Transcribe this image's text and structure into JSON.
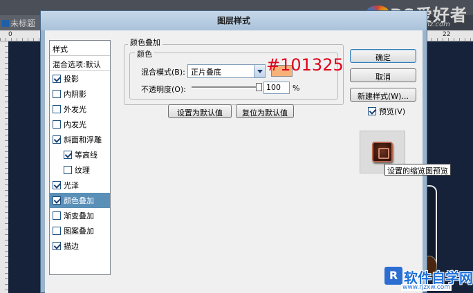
{
  "workspace": {
    "tab_title": "未标题",
    "ruler_left": "0",
    "ruler_right": "22"
  },
  "watermarks": {
    "top_brand": "PS爱好者",
    "top_url": "www.psahz.com",
    "bottom_icon": "R",
    "bottom_brand": "软件自学网",
    "bottom_url": "www.rjzxw.com"
  },
  "dialog": {
    "title": "图层样式"
  },
  "style_list": {
    "header": "样式",
    "blend_options": "混合选项:默认",
    "items": [
      {
        "label": "投影",
        "checked": true,
        "indent": false,
        "selected": false
      },
      {
        "label": "内阴影",
        "checked": false,
        "indent": false,
        "selected": false
      },
      {
        "label": "外发光",
        "checked": false,
        "indent": false,
        "selected": false
      },
      {
        "label": "内发光",
        "checked": false,
        "indent": false,
        "selected": false
      },
      {
        "label": "斜面和浮雕",
        "checked": true,
        "indent": false,
        "selected": false
      },
      {
        "label": "等高线",
        "checked": true,
        "indent": true,
        "selected": false
      },
      {
        "label": "纹理",
        "checked": false,
        "indent": true,
        "selected": false
      },
      {
        "label": "光泽",
        "checked": true,
        "indent": false,
        "selected": false
      },
      {
        "label": "颜色叠加",
        "checked": true,
        "indent": false,
        "selected": true
      },
      {
        "label": "渐变叠加",
        "checked": false,
        "indent": false,
        "selected": false
      },
      {
        "label": "图案叠加",
        "checked": false,
        "indent": false,
        "selected": false
      },
      {
        "label": "描边",
        "checked": true,
        "indent": false,
        "selected": false
      }
    ]
  },
  "color_overlay": {
    "group_title": "颜色叠加",
    "subgroup_title": "颜色",
    "blend_mode_label": "混合模式(B):",
    "blend_mode_value": "正片叠底",
    "swatch_color": "#f7b27a",
    "opacity_label": "不透明度(O):",
    "opacity_value": "100",
    "opacity_unit": "%",
    "set_default": "设置为默认值",
    "reset_default": "复位为默认值"
  },
  "annotation": {
    "hex": "#101325",
    "color": "#e0001a"
  },
  "right_panel": {
    "ok": "确定",
    "cancel": "取消",
    "new_style": "新建样式(W)...",
    "preview_label": "预览(V)",
    "preview_checked": true,
    "tooltip": "设置的缩览图预览"
  }
}
